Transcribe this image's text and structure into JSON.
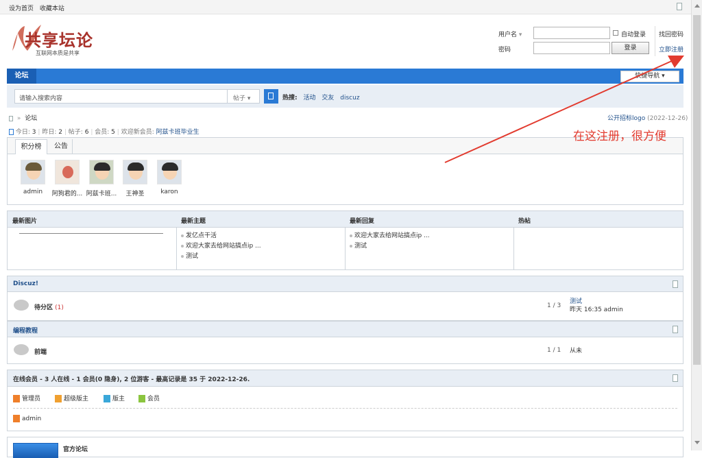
{
  "topbar": {
    "set_home": "设为首页",
    "bookmark": "收藏本站"
  },
  "logo": {
    "text": "共享坛论",
    "subtitle": "互联网本质是共享"
  },
  "login": {
    "username_label": "用户名",
    "password_label": "密码",
    "auto_login": "自动登录",
    "login_button": "登录",
    "find_password": "找回密码",
    "register": "立即注册"
  },
  "nav": {
    "tab": "论坛",
    "quick_nav": "快捷导航"
  },
  "search": {
    "placeholder": "请输入搜索内容",
    "type": "帖子",
    "hot_label": "热搜:",
    "hot": [
      "活动",
      "交友",
      "discuz"
    ]
  },
  "breadcrumb": {
    "home_sep": "»",
    "current": "论坛",
    "notice": "公开招标logo",
    "notice_date": "(2022-12-26)"
  },
  "stats": {
    "today_label": "今日:",
    "today": "3",
    "yesterday_label": "昨日:",
    "yesterday": "2",
    "posts_label": "帖子:",
    "posts": "6",
    "members_label": "会员:",
    "members": "5",
    "welcome_label": "欢迎新会员:",
    "newest": "阿兹卡班毕业生"
  },
  "rank": {
    "tab_points": "积分榜",
    "tab_notice": "公告",
    "users": [
      "admin",
      "阿狗君的...",
      "阿兹卡班...",
      "王神圣",
      "karon"
    ]
  },
  "grid": {
    "headers": [
      "最新图片",
      "最新主题",
      "最新回复",
      "热帖"
    ],
    "topics": [
      "发亿点干活",
      "欢迎大家去给网站搞点ip ...",
      "测试"
    ],
    "replies": [
      "欢迎大家去给网站搞点ip ...",
      "测试"
    ]
  },
  "category1": {
    "title": "Discuz!",
    "forum": "待分区",
    "forum_count": "(1)",
    "threads": "1 / 3",
    "last_title": "测试",
    "last_meta": "昨天 16:35 admin"
  },
  "category2": {
    "title": "编程教程",
    "forum": "前端",
    "threads": "1 / 1",
    "last": "从未"
  },
  "online": {
    "title": "在线会员 - 3 人在线 - 1 会员(0 隐身), 2 位游客 - 最高记录是 35 于 2022-12-26.",
    "legend": [
      "管理员",
      "超级版主",
      "版主",
      "会员"
    ],
    "legend_colors": [
      "#ef7f2a",
      "#f0a030",
      "#3aa7d9",
      "#8bc53f"
    ],
    "user": "admin"
  },
  "official": {
    "title": "官方论坛"
  },
  "annotation": {
    "text": "在这注册，很方便",
    "color": "#e23b2f"
  }
}
